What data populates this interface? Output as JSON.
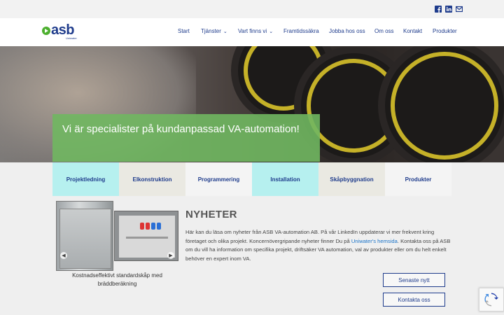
{
  "topbar": {
    "icons": [
      "facebook-icon",
      "linkedin-icon",
      "mail-icon"
    ]
  },
  "logo": {
    "text": "asb",
    "subtext": "Uniwater"
  },
  "nav": {
    "items": [
      {
        "label": "Start"
      },
      {
        "label": "Tjänster",
        "dropdown": true
      },
      {
        "label": "Vart finns vi",
        "dropdown": true
      },
      {
        "label": "Framtidssäkra"
      },
      {
        "label": "Jobba hos oss"
      },
      {
        "label": "Om oss"
      },
      {
        "label": "Kontakt"
      },
      {
        "label": "Produkter"
      }
    ]
  },
  "hero": {
    "caption": "Vi är specialister på kundanpassad VA-automation!"
  },
  "tabs": [
    {
      "label": "Projektledning",
      "color": "#b6f0ef"
    },
    {
      "label": "Elkonstruktion",
      "color": "#eae9e2"
    },
    {
      "label": "Programmering",
      "color": "#f4f4f4"
    },
    {
      "label": "Installation",
      "color": "#b6f0ef"
    },
    {
      "label": "Skåpbyggnation",
      "color": "#eae9e2"
    },
    {
      "label": "Produkter",
      "color": "#f4f4f4"
    }
  ],
  "carousel": {
    "caption": "Kostnadseffektivt standardskåp med bräddberäkning"
  },
  "news": {
    "title": "NYHETER",
    "paragraph_start": "Här kan du läsa om nyheter från ASB VA-automation AB. På vår LinkedIn uppdaterar vi mer frekvent kring företaget och olika projekt. Koncernövergripande nyheter finner Du på ",
    "link": "Uniwater's hemsida",
    "paragraph_end": ". Kontakta oss på ASB om du vill ha information om specifika projekt, driftsäker VA automation, val av produkter eller om du helt enkelt behöver en expert inom VA."
  },
  "buttons": {
    "latest": "Senaste nytt",
    "contact": "Kontakta oss"
  },
  "colors": {
    "brand_blue": "#1f3c8c",
    "brand_green": "#4caf2e",
    "caption_green": "#70b760"
  }
}
